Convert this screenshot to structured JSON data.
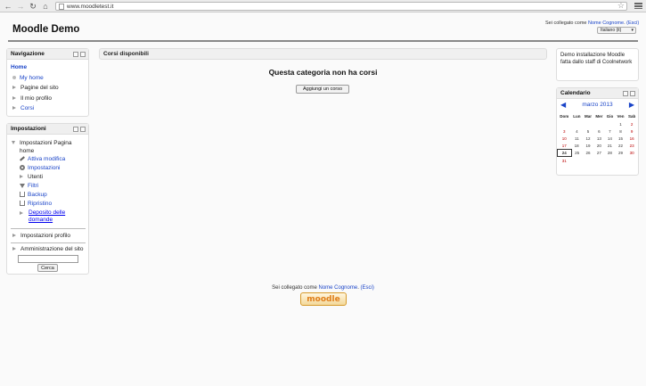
{
  "browser": {
    "url": "www.moodletest.it",
    "back_icon": "back-arrow-icon",
    "forward_icon": "forward-arrow-icon",
    "reload_icon": "reload-icon",
    "home_icon": "home-icon"
  },
  "header": {
    "site_title": "Moodle Demo",
    "login_prefix": "Sei collegato come",
    "user_name": "Nome Cognome",
    "logout": "(Esci)",
    "language": "Italiano (it)"
  },
  "navigation": {
    "title": "Navigazione",
    "home": "Home",
    "items": [
      {
        "label": "My home",
        "link": true,
        "marker": "bullet"
      },
      {
        "label": "Pagine del sito",
        "link": false,
        "marker": "arrow"
      },
      {
        "label": "Il mio profilo",
        "link": false,
        "marker": "arrow"
      },
      {
        "label": "Corsi",
        "link": true,
        "marker": "arrow"
      }
    ]
  },
  "settings": {
    "title": "Impostazioni",
    "page_settings": "Impostazioni Pagina home",
    "items": [
      {
        "label": "Attiva modifica",
        "icon": "pencil-icon",
        "link": true
      },
      {
        "label": "Impostazioni",
        "icon": "gear-icon",
        "link": true
      },
      {
        "label": "Utenti",
        "icon": "arrow",
        "link": false
      },
      {
        "label": "Filtri",
        "icon": "filter-icon",
        "link": true
      },
      {
        "label": "Backup",
        "icon": "backup-icon",
        "link": true
      },
      {
        "label": "Ripristino",
        "icon": "restore-icon",
        "link": true
      },
      {
        "label": "Deposito delle domande",
        "icon": "arrow",
        "link": true
      }
    ],
    "profile_settings": "Impostazioni profilo",
    "site_admin": "Amministrazione del sito",
    "search_button": "Cerca",
    "search_value": ""
  },
  "main": {
    "heading": "Corsi disponibili",
    "empty_message": "Questa categoria non ha corsi",
    "add_course_button": "Aggiungi un corso"
  },
  "info_block": {
    "text": "Demo installazione Moodle fatta dallo staff di Coolnetwork"
  },
  "calendar": {
    "title": "Calendario",
    "month": "marzo 2013",
    "weekdays": [
      "Dom",
      "Lun",
      "Mar",
      "Mer",
      "Gio",
      "Ven",
      "Sab"
    ],
    "weeks": [
      [
        "",
        "",
        "",
        "",
        "",
        "1",
        "2"
      ],
      [
        "3",
        "4",
        "5",
        "6",
        "7",
        "8",
        "9"
      ],
      [
        "10",
        "11",
        "12",
        "13",
        "14",
        "15",
        "16"
      ],
      [
        "17",
        "18",
        "19",
        "20",
        "21",
        "22",
        "23"
      ],
      [
        "24",
        "25",
        "26",
        "27",
        "28",
        "29",
        "30"
      ],
      [
        "31",
        "",
        "",
        "",
        "",
        "",
        ""
      ]
    ],
    "today": "24",
    "weekend_color": "#b00000"
  },
  "footer": {
    "login_prefix": "Sei collegato come",
    "user_name": "Nome Cognome",
    "logout": "(Esci)",
    "logo_text": "moodle"
  },
  "colors": {
    "link": "#1a44c8",
    "header_rule": "#8a8a8a",
    "logo_accent": "#e07f1b"
  }
}
